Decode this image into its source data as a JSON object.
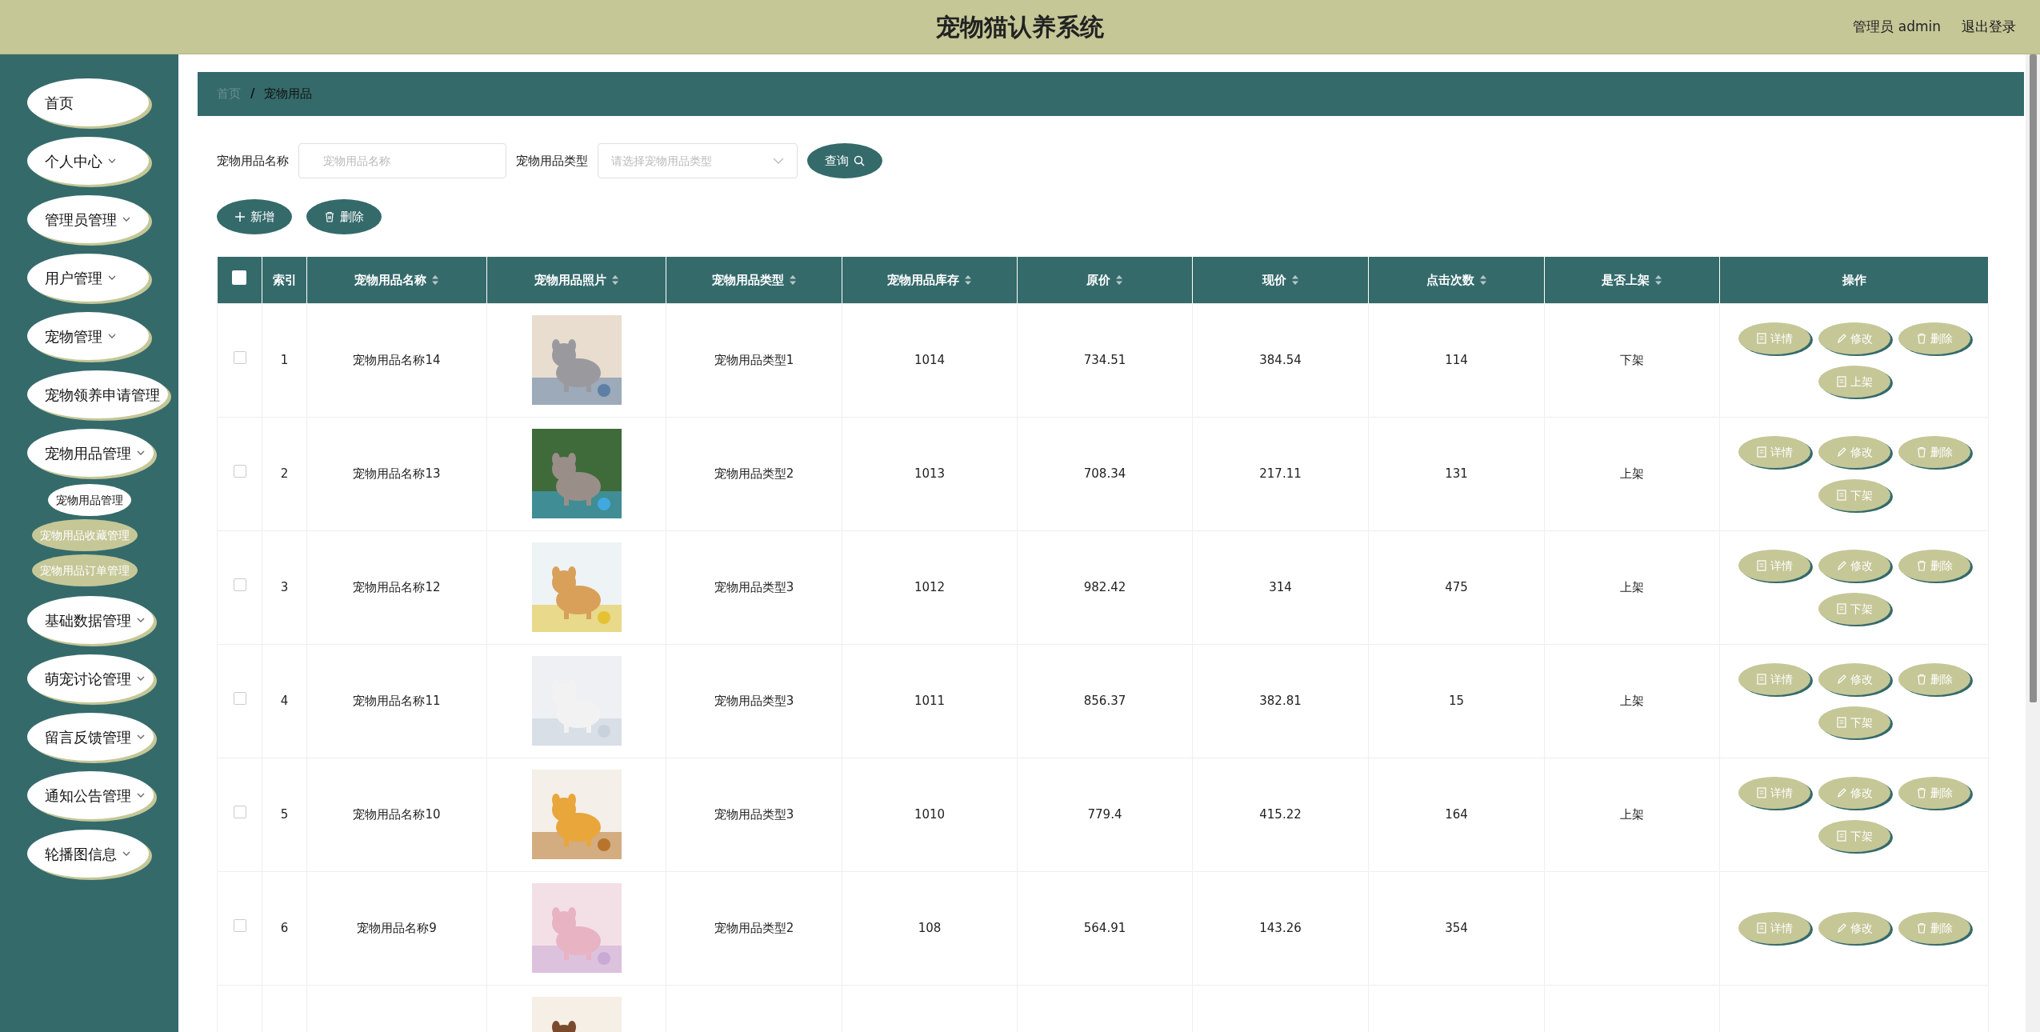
{
  "header": {
    "title": "宠物猫认养系统",
    "user": "管理员 admin",
    "logout": "退出登录"
  },
  "sidebar": {
    "items": [
      {
        "label": "首页",
        "expandable": false
      },
      {
        "label": "个人中心",
        "expandable": true
      },
      {
        "label": "管理员管理",
        "expandable": true
      },
      {
        "label": "用户管理",
        "expandable": true
      },
      {
        "label": "宠物管理",
        "expandable": true
      },
      {
        "label": "宠物领养申请管理",
        "expandable": false
      },
      {
        "label": "宠物用品管理",
        "expandable": true,
        "children": [
          {
            "label": "宠物用品管理",
            "selected": true
          },
          {
            "label": "宠物用品收藏管理",
            "selected": false
          },
          {
            "label": "宠物用品订单管理",
            "selected": false
          }
        ]
      },
      {
        "label": "基础数据管理",
        "expandable": true
      },
      {
        "label": "萌宠讨论管理",
        "expandable": true
      },
      {
        "label": "留言反馈管理",
        "expandable": true
      },
      {
        "label": "通知公告管理",
        "expandable": true
      },
      {
        "label": "轮播图信息",
        "expandable": true
      }
    ]
  },
  "breadcrumb": {
    "items": [
      "首页",
      "宠物用品"
    ],
    "separator": "/"
  },
  "search": {
    "fields": [
      {
        "kind": "text",
        "label": "宠物用品名称",
        "placeholder": "宠物用品名称"
      },
      {
        "kind": "select",
        "label": "宠物用品类型",
        "placeholder": "请选择宠物用品类型"
      }
    ],
    "button": "查询"
  },
  "toolbar": [
    "新增",
    "删除"
  ],
  "table": {
    "select_all_checked": false,
    "columns": [
      {
        "label": "索引",
        "sortable": false
      },
      {
        "label": "宠物用品名称",
        "sortable": true
      },
      {
        "label": "宠物用品照片",
        "sortable": true
      },
      {
        "label": "宠物用品类型",
        "sortable": true
      },
      {
        "label": "宠物用品库存",
        "sortable": true
      },
      {
        "label": "原价",
        "sortable": true
      },
      {
        "label": "现价",
        "sortable": true
      },
      {
        "label": "点击次数",
        "sortable": true
      },
      {
        "label": "是否上架",
        "sortable": true
      },
      {
        "label": "操作",
        "sortable": false
      }
    ],
    "rows": [
      {
        "checked": false,
        "cells": [
          "1",
          "宠物用品名称14",
          {
            "kind": "picture"
          },
          "宠物用品类型1",
          "1014",
          "734.51",
          "384.54",
          "114",
          "下架"
        ],
        "actions": [
          "详情",
          "修改",
          "删除",
          "上架"
        ]
      },
      {
        "checked": false,
        "cells": [
          "2",
          "宠物用品名称13",
          {
            "kind": "picture"
          },
          "宠物用品类型2",
          "1013",
          "708.34",
          "217.11",
          "131",
          "上架"
        ],
        "actions": [
          "详情",
          "修改",
          "删除",
          "下架"
        ]
      },
      {
        "checked": false,
        "cells": [
          "3",
          "宠物用品名称12",
          {
            "kind": "picture"
          },
          "宠物用品类型3",
          "1012",
          "982.42",
          "314",
          "475",
          "上架"
        ],
        "actions": [
          "详情",
          "修改",
          "删除",
          "下架"
        ]
      },
      {
        "checked": false,
        "cells": [
          "4",
          "宠物用品名称11",
          {
            "kind": "picture"
          },
          "宠物用品类型3",
          "1011",
          "856.37",
          "382.81",
          "15",
          "上架"
        ],
        "actions": [
          "详情",
          "修改",
          "删除",
          "下架"
        ]
      },
      {
        "checked": false,
        "cells": [
          "5",
          "宠物用品名称10",
          {
            "kind": "picture"
          },
          "宠物用品类型3",
          "1010",
          "779.4",
          "415.22",
          "164",
          "上架"
        ],
        "actions": [
          "详情",
          "修改",
          "删除",
          "下架"
        ]
      },
      {
        "checked": false,
        "cells": [
          "6",
          "宠物用品名称9",
          {
            "kind": "picture"
          },
          "宠物用品类型2",
          "108",
          "564.91",
          "143.26",
          "354"
        ],
        "actions": [
          "详情",
          "修改",
          "删除"
        ]
      },
      {
        "cells": [
          null,
          null,
          {
            "kind": "picture"
          }
        ]
      }
    ]
  }
}
